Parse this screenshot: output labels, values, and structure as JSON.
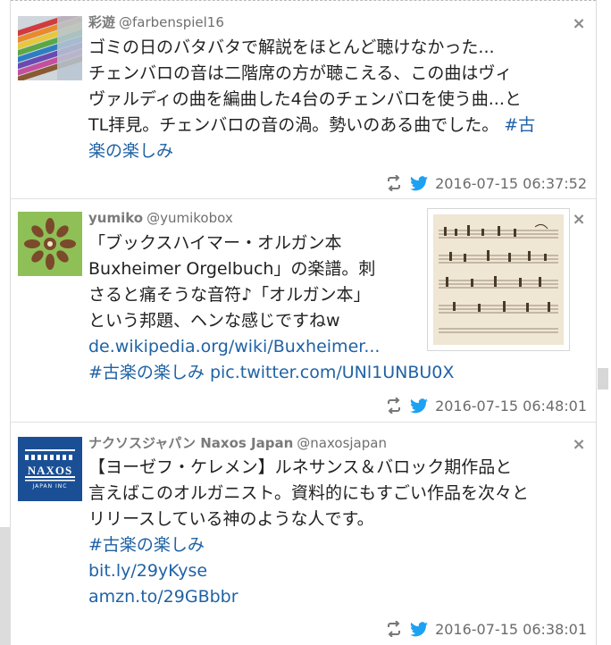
{
  "tweets": [
    {
      "author_name": "彩遊",
      "handle": "@farbenspiel16",
      "text_lines": [
        "ゴミの日のバタバタで解説をほとんど聴けなかった...",
        "チェンバロの音は二階席の方が聴こえる、この曲はヴィ",
        "ヴァルディの曲を編曲した4台のチェンバロを使う曲...と",
        "TL拝見。チェンバロの音の渦。勢いのある曲でした。"
      ],
      "tag_part1": "#古",
      "tag_part2": "楽の楽しみ",
      "timestamp": "2016-07-15 06:37:52",
      "close_label": "×"
    },
    {
      "author_name": "yumiko",
      "handle": "@yumikobox",
      "text_lines": [
        "「ブックスハイマー・オルガン本",
        "Buxheimer Orgelbuch」の楽譜。刺",
        "さると痛そうな音符♪「オルガン本」",
        "という邦題、ヘンな感じですねw"
      ],
      "link": "de.wikipedia.org/wiki/Buxheimer...",
      "tag": "#古楽の楽しみ",
      "pic_link": "pic.twitter.com/UNl1UNBU0X",
      "timestamp": "2016-07-15 06:48:01",
      "close_label": "×"
    },
    {
      "author_name": "ナクソスジャパン Naxos Japan",
      "handle": "@naxosjapan",
      "avatar_text": "NAXOS",
      "avatar_subtext": "JAPAN INC",
      "text_lines": [
        "【ヨーゼフ・ケレメン】ルネサンス＆バロック期作品と",
        "言えばこのオルガニスト。資料的にもすごい作品を次々と",
        "リリースしている神のような人です。"
      ],
      "tag": "#古楽の楽しみ",
      "link1": "bit.ly/29yKyse",
      "link2": "amzn.to/29GBbbr",
      "timestamp": "2016-07-15 06:38:01",
      "close_label": "×"
    }
  ],
  "icons": {
    "retweet": "retweet-icon",
    "twitter": "twitter-bird-icon",
    "close": "close-icon"
  },
  "colors": {
    "link": "#1f62a5",
    "twitter_blue": "#1da1f2",
    "naxos_blue": "#1a4f95"
  }
}
